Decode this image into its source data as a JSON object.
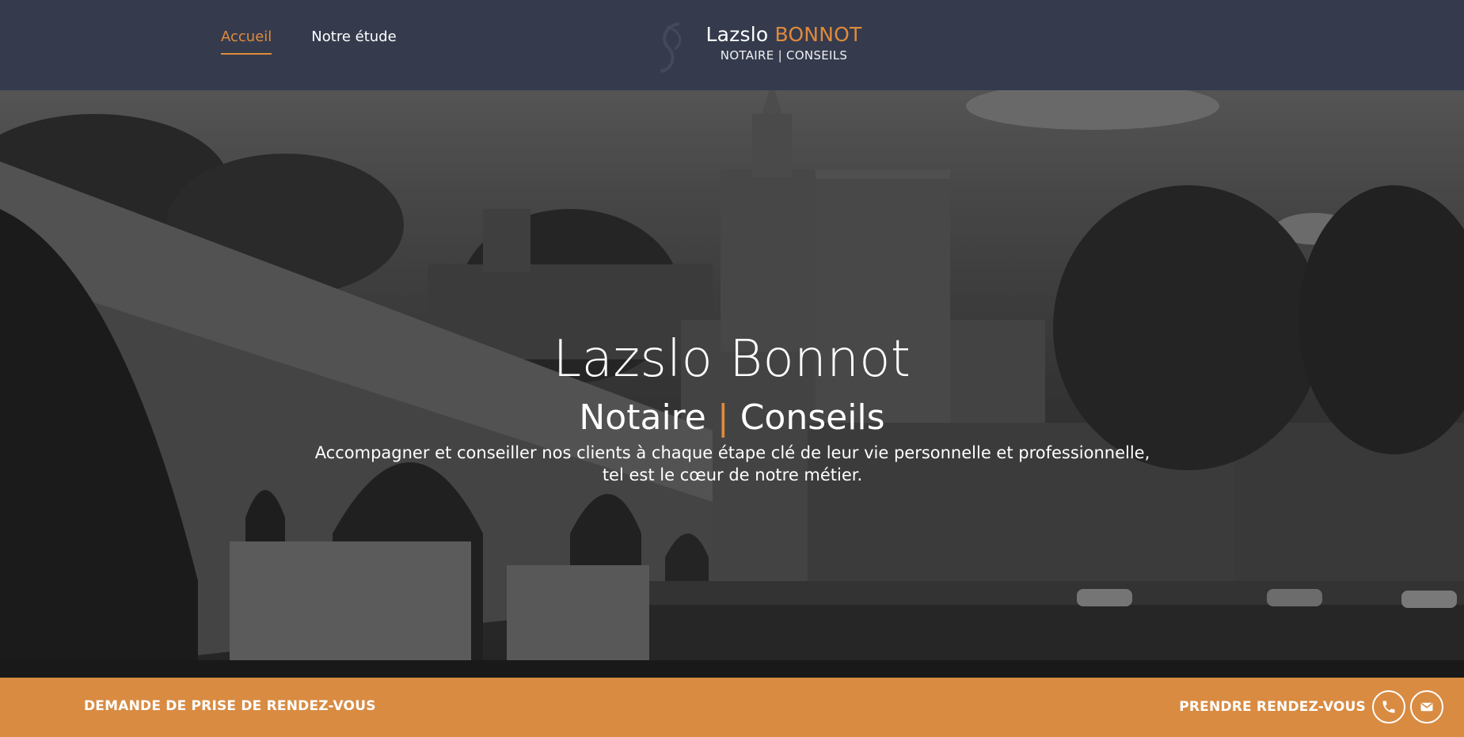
{
  "nav": {
    "items": [
      {
        "label": "Accueil",
        "active": true
      },
      {
        "label": "Notre étude",
        "active": false
      }
    ]
  },
  "brand": {
    "first_name": "Lazslo",
    "last_name": "BONNOT",
    "subtitle": "NOTAIRE | CONSEILS",
    "accent_color": "#e08a3c"
  },
  "hero": {
    "title": "Lazslo Bonnot",
    "subtitle_left": "Notaire",
    "subtitle_sep": "|",
    "subtitle_right": "Conseils",
    "description": "Accompagner et conseiller nos clients à chaque étape clé de leur vie personnelle et professionnelle, tel est le cœur de notre métier."
  },
  "cta": {
    "left_label": "DEMANDE DE PRISE DE RENDEZ-VOUS",
    "right_label": "PRENDRE RENDEZ-VOUS",
    "phone_icon": "phone-icon",
    "mail_icon": "mail-icon",
    "bar_color": "#d98b42"
  },
  "colors": {
    "header_bg": "#353b4d",
    "accent": "#e08a3c"
  }
}
